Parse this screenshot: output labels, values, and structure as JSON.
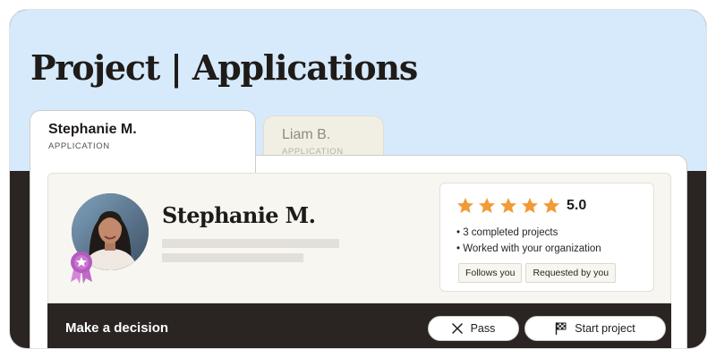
{
  "header": {
    "title": "Project | Applications"
  },
  "tabs": [
    {
      "name": "Stephanie M.",
      "subtitle": "APPLICATION",
      "active": true
    },
    {
      "name": "Liam B.",
      "subtitle": "APPLICATION",
      "active": false
    }
  ],
  "applicant": {
    "name": "Stephanie M.",
    "avatar_icon": "profile-photo",
    "badge_icon": "award-ribbon-icon",
    "rating": "5.0",
    "stars": 5,
    "highlights": [
      "• 3 completed projects",
      "• Worked with your organization"
    ],
    "tags": [
      "Follows you",
      "Requested by you"
    ]
  },
  "decision": {
    "label": "Make a decision",
    "pass_label": "Pass",
    "pass_icon": "close-icon",
    "start_label": "Start project",
    "start_icon": "flag-icon"
  },
  "colors": {
    "header_bg": "#d6eafc",
    "dark": "#2a2523",
    "star": "#f29a36",
    "badge": "#b55bc0"
  }
}
